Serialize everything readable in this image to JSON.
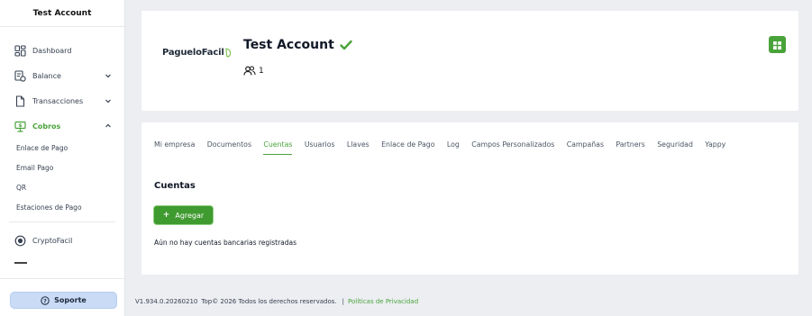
{
  "sidebar": {
    "account_name": "Test Account",
    "items": [
      {
        "label": "Dashboard",
        "icon": "dashboard-icon"
      },
      {
        "label": "Balance",
        "icon": "balance-icon",
        "chevron": "down"
      },
      {
        "label": "Transacciones",
        "icon": "document-icon",
        "chevron": "down"
      },
      {
        "label": "Cobros",
        "icon": "cobros-icon",
        "chevron": "up",
        "active": true
      }
    ],
    "cobros_subitems": [
      "Enlace de Pago",
      "Email Pago",
      "QR",
      "Estaciones de Pago"
    ],
    "crypto": {
      "label": "CryptoFacil",
      "icon": "crypto-icon"
    },
    "support_label": "Soporte"
  },
  "header": {
    "logo_text": "PagueloFacil",
    "account_title": "Test Account",
    "users_count": "1"
  },
  "tabs": [
    "Mi empresa",
    "Documentos",
    "Cuentas",
    "Usuarios",
    "Llaves",
    "Enlace de Pago",
    "Log",
    "Campos Personalizados",
    "Campañas",
    "Partners",
    "Seguridad",
    "Yappy"
  ],
  "active_tab": "Cuentas",
  "main": {
    "section_title": "Cuentas",
    "add_button_label": "Agregar",
    "empty_message": "Aún no hay cuentas bancarias registradas"
  },
  "footer": {
    "version_text": "V1.934.0.20260210",
    "copyright": "Top© 2026 Todos los derechos reservados.",
    "separator": "|",
    "privacy_link": "Políticas de Privacidad"
  },
  "colors": {
    "accent_green": "#4aa33a",
    "support_bg": "#c9dbf5",
    "page_bg": "#eceef2"
  }
}
